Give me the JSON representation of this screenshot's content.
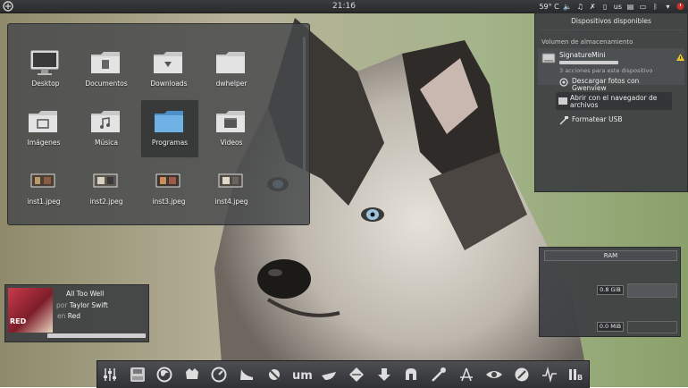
{
  "topbar": {
    "clock": "21:16",
    "temperature": "59° C",
    "keyboard_layout": "us"
  },
  "folderview": {
    "items": [
      {
        "label": "Desktop",
        "icon": "monitor-icon"
      },
      {
        "label": "Documentos",
        "icon": "folder-documents-icon"
      },
      {
        "label": "Downloads",
        "icon": "folder-downloads-icon"
      },
      {
        "label": "dwhelper",
        "icon": "folder-icon"
      },
      {
        "label": "Imágenes",
        "icon": "folder-images-icon"
      },
      {
        "label": "Música",
        "icon": "folder-music-icon"
      },
      {
        "label": "Programas",
        "icon": "folder-blue-icon",
        "selected": true
      },
      {
        "label": "Videos",
        "icon": "folder-videos-icon"
      },
      {
        "label": "inst1.jpeg",
        "icon": "image-thumbnail-icon"
      },
      {
        "label": "inst2.jpeg",
        "icon": "image-thumbnail-icon"
      },
      {
        "label": "inst3.jpeg",
        "icon": "image-thumbnail-icon"
      },
      {
        "label": "inst4.jpeg",
        "icon": "image-thumbnail-icon"
      }
    ]
  },
  "devices": {
    "header": "Dispositivos disponibles",
    "section": "Volumen de almacenamiento",
    "device_name": "SignatureMini",
    "actions_count": "3 acciones para este dispositivo",
    "action1": "Descargar fotos con Gwenview",
    "action2": "Abrir con el navegador de archivos",
    "action3": "Formatear USB"
  },
  "player": {
    "title": "All Too Well",
    "by_label": "por",
    "artist": "Taylor Swift",
    "on_label": "en",
    "album": "Red",
    "cover_text": "RED"
  },
  "sysmon": {
    "title": "RAM",
    "ram_used": "0.8 GiB",
    "swap_used": "0.0 MiB"
  },
  "dock": {
    "items": [
      "mixer-icon",
      "disk-icon",
      "firefox-icon",
      "gimp-icon",
      "speed-icon",
      "shoe-icon",
      "no-bug-icon",
      "um-icon",
      "boat-icon",
      "inkscape-icon",
      "download-arrow-icon",
      "skype-icon",
      "pipette-icon",
      "pdf-icon",
      "eye-icon",
      "compass-icon",
      "pulse-icon",
      "storage-icon"
    ]
  },
  "colors": {
    "panel_bg": "#3c3e41",
    "accent_blue": "#6fb3e6",
    "warning": "#e8c22a"
  }
}
